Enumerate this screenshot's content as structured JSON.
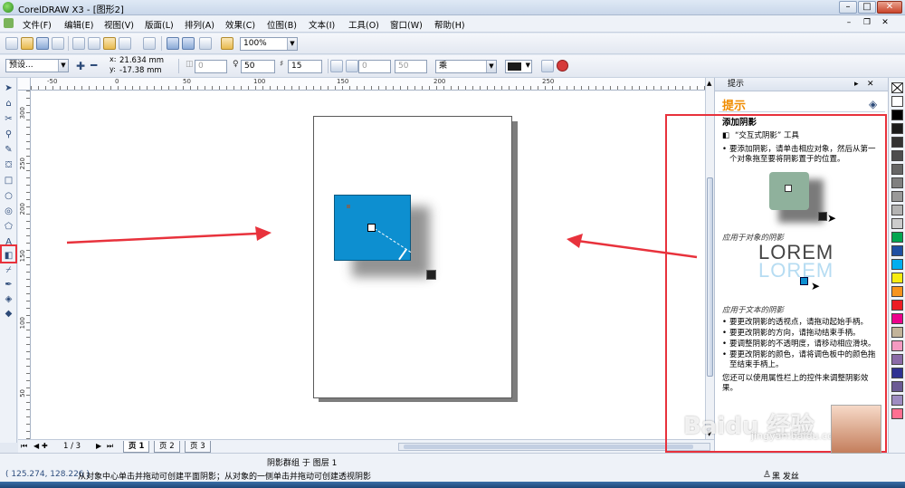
{
  "titlebar": {
    "title": "CorelDRAW X3 - [图形2]"
  },
  "menu": {
    "items": [
      "文件(F)",
      "编辑(E)",
      "视图(V)",
      "版面(L)",
      "排列(A)",
      "效果(C)",
      "位图(B)",
      "文本(I)",
      "工具(O)",
      "窗口(W)",
      "帮助(H)"
    ]
  },
  "standard_toolbar": {
    "zoom": "100%"
  },
  "property_bar": {
    "preset": "预设...",
    "x": "21.634 mm",
    "y": "-17.38 mm",
    "shadow_angle": "0",
    "opacity": "50",
    "feather": "15",
    "fade": "0",
    "stretch": "50",
    "merge_mode": "乘"
  },
  "rulers": {
    "h": [
      "-50",
      "0",
      "50",
      "100",
      "150",
      "200",
      "250"
    ],
    "v": [
      "300",
      "250",
      "200",
      "150",
      "100",
      "50"
    ]
  },
  "pages": {
    "count": "1 / 3",
    "tabs": [
      "页 1",
      "页 2",
      "页 3"
    ]
  },
  "status": {
    "selection": "阴影群组 于 图层 1",
    "coords": "( 125.274, 128.226 )",
    "hint": "从对象中心单击并拖动可创建平面阴影；从对象的一侧单击并拖动可创建透视阴影",
    "fill_label": "黑 发丝"
  },
  "docker": {
    "tab": "提示",
    "title": "提示",
    "heading": "添加阴影",
    "tool_line": "“交互式阴影” 工具",
    "intro": "要添加阴影，请单击相应对象，然后从第一个对象拖至要将阴影置于的位置。",
    "caption_object": "应用于对象的阴影",
    "lorem": "LOREM",
    "caption_text": "应用于文本的阴影",
    "bullets": [
      "要更改阴影的透视点，请拖动起始手柄。",
      "要更改阴影的方向，请拖动结束手柄。",
      "要调整阴影的不透明度，请移动相应滑块。",
      "要更改阴影的颜色，请将调色板中的颜色拖至结束手柄上。"
    ],
    "footer": "您还可以使用属性栏上的控件来调整阴影效果。"
  },
  "palette": [
    "#ffffff",
    "#000000",
    "#1a1a1a",
    "#333333",
    "#4d4d4d",
    "#666666",
    "#808080",
    "#999999",
    "#b3b3b3",
    "#cccccc",
    "#00a651",
    "#1e4fa3",
    "#00aeef",
    "#f7ec13",
    "#f7941d",
    "#ed1c24",
    "#ec008c",
    "#c2b49a",
    "#f49ac1",
    "#8b6ba8",
    "#2e3192",
    "#6b5b95",
    "#9e8cc2",
    "#ff6f91"
  ],
  "watermark": {
    "brand": "Baidu 经验",
    "url": "jingyan.baidu.com"
  }
}
